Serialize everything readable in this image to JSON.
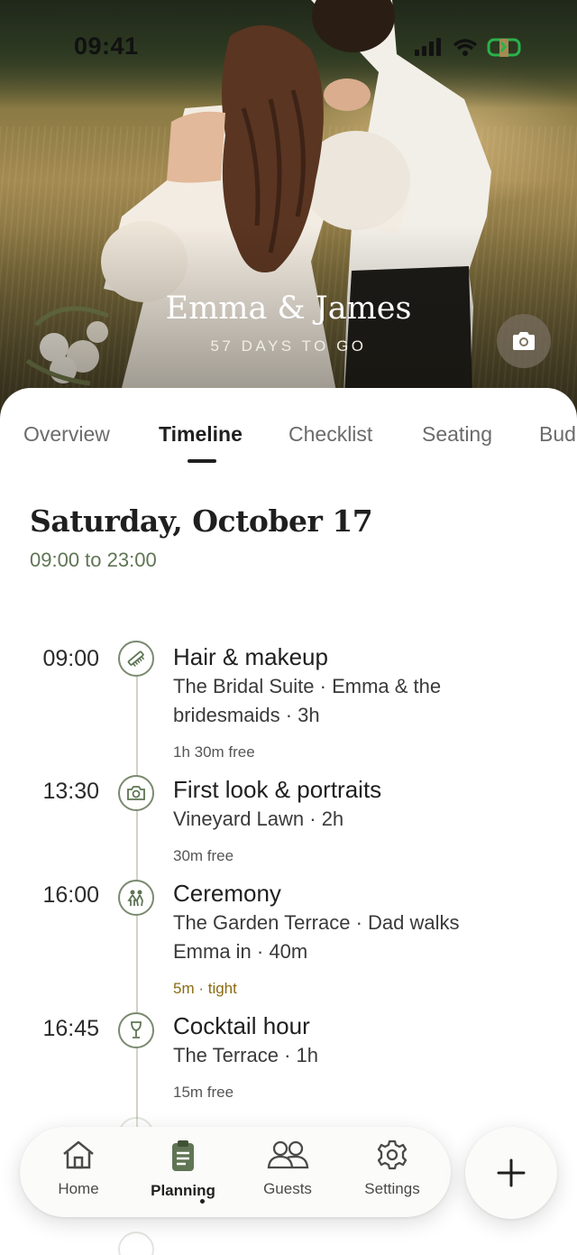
{
  "status_bar": {
    "time": "09:41"
  },
  "hero": {
    "couple_names": "Emma & James",
    "countdown": "57 DAYS TO GO",
    "camera_icon": "camera-icon"
  },
  "tabs": [
    {
      "label": "Overview",
      "active": false
    },
    {
      "label": "Timeline",
      "active": true
    },
    {
      "label": "Checklist",
      "active": false
    },
    {
      "label": "Seating",
      "active": false
    },
    {
      "label": "Bud",
      "active": false
    }
  ],
  "day": {
    "title": "Saturday, October 17",
    "range": "09:00 to 23:00"
  },
  "events": [
    {
      "time": "09:00",
      "icon": "comb-icon",
      "title": "Hair & makeup",
      "detail": "The Bridal Suite · Emma & the bridesmaids · 3h",
      "gap": "1h 30m free"
    },
    {
      "time": "13:30",
      "icon": "camera-icon",
      "title": "First look & portraits",
      "detail": "Vineyard Lawn · 2h",
      "gap": "30m free"
    },
    {
      "time": "16:00",
      "icon": "couple-icon",
      "title": "Ceremony",
      "detail": "The Garden Terrace · Dad walks Emma in · 40m",
      "gap": "5m · tight"
    },
    {
      "time": "16:45",
      "icon": "glass-icon",
      "title": "Cocktail hour",
      "detail": "The Terrace · 1h",
      "gap": "15m free"
    }
  ],
  "nav": {
    "items": [
      {
        "label": "Home",
        "icon": "home-icon"
      },
      {
        "label": "Planning",
        "icon": "clipboard-icon",
        "active": true
      },
      {
        "label": "Guests",
        "icon": "users-icon"
      },
      {
        "label": "Settings",
        "icon": "gear-icon"
      }
    ],
    "fab_icon": "plus-icon"
  },
  "colors": {
    "accent_green": "#5f7554",
    "tight_warning": "#8b6a12",
    "timeline_line": "#d6d1c4"
  }
}
